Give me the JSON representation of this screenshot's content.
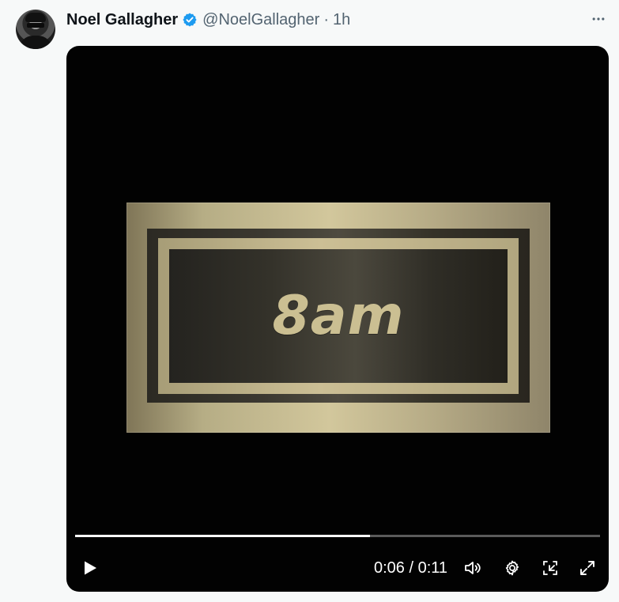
{
  "author": {
    "name": "Noel Gallagher",
    "handle": "@NoelGallagher",
    "separator": "·",
    "time": "1h",
    "verified": true
  },
  "icons": {
    "avatar": "profile-photo",
    "verified": "verified-badge-icon",
    "more": "more-options-icon",
    "play": "play-icon",
    "volume": "volume-icon",
    "settings": "gear-icon",
    "pip": "picture-in-picture-icon",
    "fullscreen": "fullscreen-icon"
  },
  "media": {
    "plate_text": "8am",
    "current_time": "0:06",
    "duration": "0:11",
    "time_display": "0:06 / 0:11",
    "progress": 0.561
  },
  "colors": {
    "verified": "#1d9bf0",
    "name": "#0f1419",
    "muted": "#536471",
    "video_bg": "#020202",
    "plate_gold": "#cbbf92"
  }
}
